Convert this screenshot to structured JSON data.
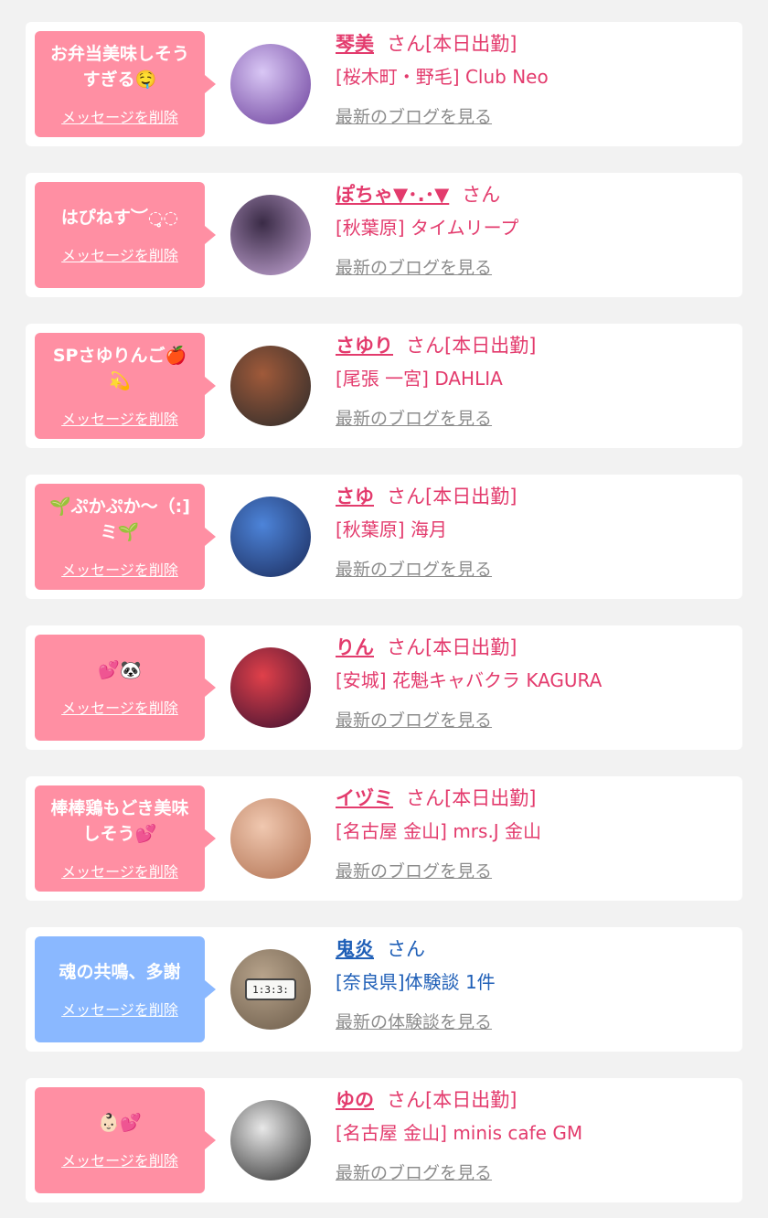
{
  "colors": {
    "card_pink": "#ff8fa3",
    "card_blue": "#8ab8ff",
    "name_pink": "#e33b6d",
    "name_blue": "#1f5fb7",
    "link_gray": "#8c8c8c",
    "background": "#f2f2f2"
  },
  "items": [
    {
      "theme": "pink",
      "message": "お弁当美味しそう\nすぎる🤤",
      "delete_label": "メッセージを削除",
      "avatar": {
        "colors": [
          "#d9c7f5",
          "#6a3d9a"
        ]
      },
      "name": "琴美",
      "honorific": "さん[本日出勤]",
      "shop": "[桜木町・野毛] Club Neo",
      "blog_label": "最新のブログを見る"
    },
    {
      "theme": "pink",
      "message": "はぴねす︶◌̥◌",
      "delete_label": "メッセージを削除",
      "avatar": {
        "colors": [
          "#3a2b46",
          "#c7a8d8"
        ]
      },
      "name": "ぽちゃ▼･.･▼",
      "honorific": "さん",
      "shop": "[秋葉原] タイムリープ",
      "blog_label": "最新のブログを見る"
    },
    {
      "theme": "pink",
      "message": "SPさゆりんご🍎\n💫",
      "delete_label": "メッセージを削除",
      "avatar": {
        "colors": [
          "#a05a3a",
          "#2a2a2a"
        ]
      },
      "name": "さゆり",
      "honorific": "さん[本日出勤]",
      "shop": "[尾張 一宮] DAHLIA",
      "blog_label": "最新のブログを見る"
    },
    {
      "theme": "pink",
      "message": "🌱ぷかぷか〜（:]\nミ🌱",
      "delete_label": "メッセージを削除",
      "avatar": {
        "colors": [
          "#4d84d9",
          "#1a2a5a"
        ]
      },
      "name": "さゆ",
      "honorific": "さん[本日出勤]",
      "shop": "[秋葉原] 海月",
      "blog_label": "最新のブログを見る"
    },
    {
      "theme": "pink",
      "message": "💕🐼",
      "delete_label": "メッセージを削除",
      "avatar": {
        "colors": [
          "#e0404a",
          "#3a1030"
        ]
      },
      "name": "りん",
      "honorific": "さん[本日出勤]",
      "shop": "[安城] 花魁キャバクラ KAGURA",
      "blog_label": "最新のブログを見る"
    },
    {
      "theme": "pink",
      "message": "棒棒鶏もどき美味\nしそう💕",
      "delete_label": "メッセージを削除",
      "avatar": {
        "colors": [
          "#f0c8b0",
          "#b07050"
        ]
      },
      "name": "イヅミ",
      "honorific": "さん[本日出勤]",
      "shop": "[名古屋 金山] mrs.J 金山",
      "blog_label": "最新のブログを見る"
    },
    {
      "theme": "blue",
      "message": "魂の共鳴、多謝",
      "delete_label": "メッセージを削除",
      "avatar": {
        "colors": [
          "#b8a48c",
          "#6a5a48"
        ],
        "caption": "1:3:3:"
      },
      "name": "鬼炎",
      "honorific": "さん",
      "shop": "[奈良県]体験談 1件",
      "blog_label": "最新の体験談を見る"
    },
    {
      "theme": "pink",
      "message": "👶🏻💕",
      "delete_label": "メッセージを削除",
      "avatar": {
        "colors": [
          "#e8e8e8",
          "#2a2a2a"
        ]
      },
      "name": "ゆの",
      "honorific": "さん[本日出勤]",
      "shop": "[名古屋 金山] minis cafe GM",
      "blog_label": "最新のブログを見る"
    }
  ]
}
